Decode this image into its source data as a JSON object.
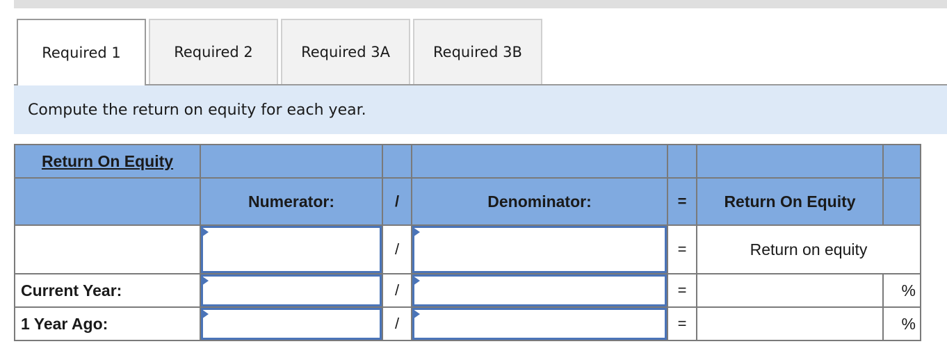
{
  "tabs": [
    {
      "label": "Required 1",
      "active": true
    },
    {
      "label": "Required 2",
      "active": false
    },
    {
      "label": "Required 3A",
      "active": false
    },
    {
      "label": "Required 3B",
      "active": false
    }
  ],
  "instructions": "Compute the return on equity for each year.",
  "table": {
    "title": "Return On Equity",
    "headers": {
      "numerator": "Numerator:",
      "divide": "/",
      "denominator": "Denominator:",
      "equals": "=",
      "result": "Return On Equity"
    },
    "rows": [
      {
        "label": "",
        "numerator": "",
        "divide": "/",
        "denominator": "",
        "equals": "=",
        "result": "Return on equity",
        "unit": ""
      },
      {
        "label": "Current Year:",
        "numerator": "",
        "divide": "/",
        "denominator": "",
        "equals": "=",
        "result": "",
        "unit": "%"
      },
      {
        "label": "1 Year Ago:",
        "numerator": "",
        "divide": "/",
        "denominator": "",
        "equals": "=",
        "result": "",
        "unit": "%"
      }
    ]
  },
  "colors": {
    "header_blue": "#80aae0",
    "instruction_band": "#dde9f7",
    "input_border": "#4a74b8",
    "inactive_tab": "#f2f2f2"
  }
}
